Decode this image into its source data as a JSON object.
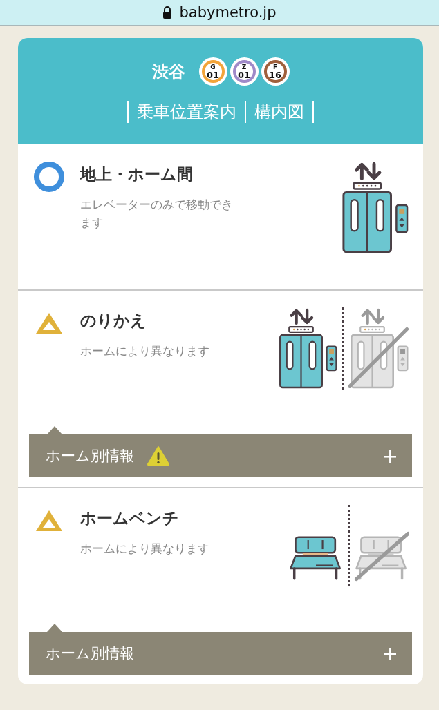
{
  "browser": {
    "url": "babymetro.jp"
  },
  "station": {
    "name": "渋谷",
    "lines": [
      {
        "letter": "G",
        "number": "01",
        "color": "#f2a43a"
      },
      {
        "letter": "Z",
        "number": "01",
        "color": "#9f8ac8"
      },
      {
        "letter": "F",
        "number": "16",
        "color": "#a0603c"
      }
    ]
  },
  "nav_links": [
    "乗車位置案内",
    "構内図"
  ],
  "items": [
    {
      "status_icon": {
        "kind": "circle"
      },
      "title": "地上・ホーム間",
      "description": "エレベーターのみで移動できます",
      "illustration": {
        "kind": "elevator",
        "partial": false
      }
    },
    {
      "status_icon": {
        "kind": "triangle"
      },
      "title": "のりかえ",
      "description": "ホームにより異なります",
      "illustration": {
        "kind": "elevator",
        "partial": true
      },
      "platform_info": {
        "label": "ホーム別情報",
        "warning": true,
        "toggle": "+"
      }
    },
    {
      "status_icon": {
        "kind": "triangle"
      },
      "title": "ホームベンチ",
      "description": "ホームにより異なります",
      "illustration": {
        "kind": "bench",
        "partial": true
      },
      "platform_info": {
        "label": "ホーム別情報",
        "warning": false,
        "toggle": "+"
      }
    }
  ]
}
